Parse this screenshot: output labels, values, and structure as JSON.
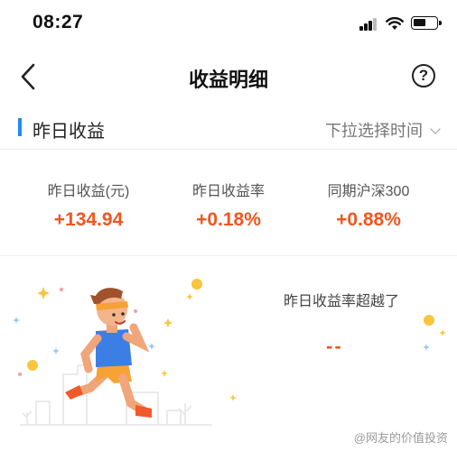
{
  "status_bar": {
    "time": "08:27"
  },
  "nav": {
    "title": "收益明细",
    "help_icon_text": "?"
  },
  "section": {
    "title": "昨日收益",
    "time_picker": "下拉选择时间"
  },
  "stats": [
    {
      "label": "昨日收益(元)",
      "value": "+134.94"
    },
    {
      "label": "昨日收益率",
      "value": "+0.18%"
    },
    {
      "label": "同期沪深300",
      "value": "+0.88%"
    }
  ],
  "beat": {
    "label": "昨日收益率超越了",
    "value": "--"
  },
  "watermark": "@网友的价值投资",
  "colors": {
    "accent_blue": "#1f8cf0",
    "gain_orange": "#f0561f"
  },
  "icons": [
    "signal-icon",
    "wifi-icon",
    "battery-icon",
    "back-icon",
    "help-icon",
    "chevron-down-icon"
  ]
}
